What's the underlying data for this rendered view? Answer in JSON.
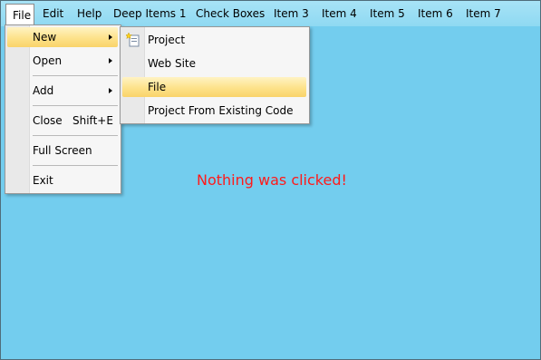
{
  "menubar": {
    "items": [
      "File",
      "Edit",
      "Help",
      "Deep Items 1",
      "Check Boxes",
      "Item 3",
      "Item 4",
      "Item 5",
      "Item 6",
      "Item 7"
    ]
  },
  "file_menu": {
    "new": "New",
    "open": "Open",
    "add": "Add",
    "close": "Close",
    "close_shortcut": "Shift+E",
    "full_screen": "Full Screen",
    "exit": "Exit"
  },
  "new_menu": {
    "project": "Project",
    "web_site": "Web Site",
    "file": "File",
    "project_from_existing": "Project From Existing Code"
  },
  "status_text": "Nothing was clicked!",
  "colors": {
    "background": "#73cdee",
    "menubar": "#a7e3f6",
    "highlight": "#fde28a",
    "status": "#ff1a1a"
  }
}
